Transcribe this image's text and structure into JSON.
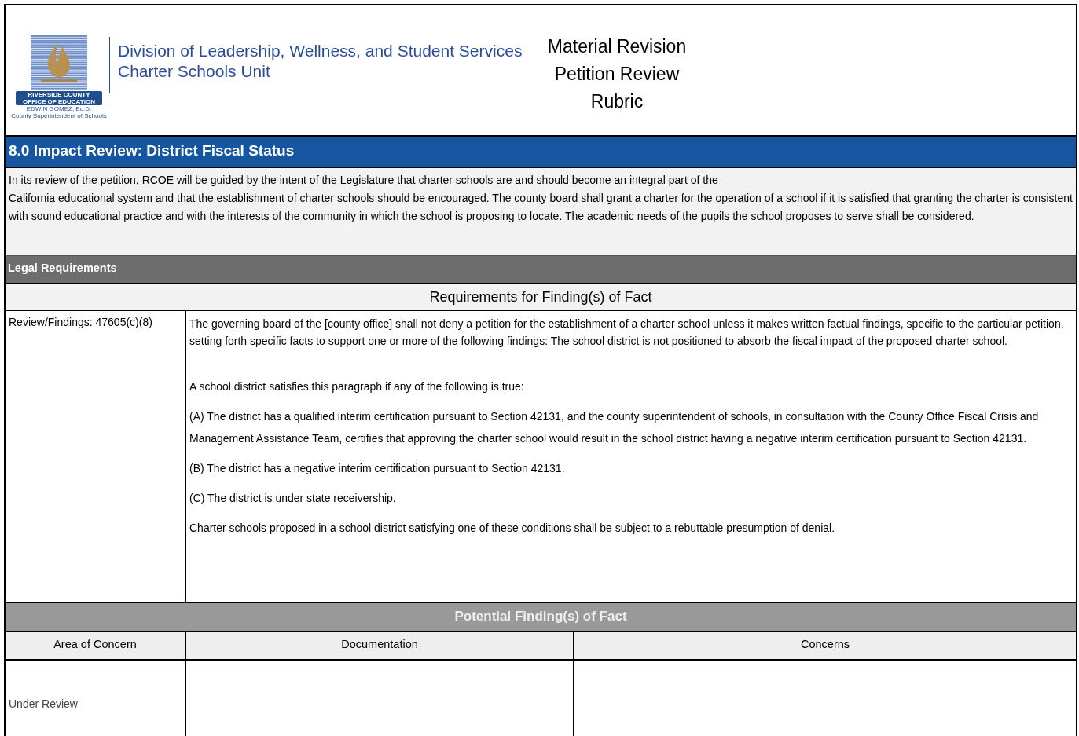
{
  "header": {
    "logo": {
      "badge_lines": [
        "RIVERSIDE COUNTY",
        "OFFICE OF EDUCATION"
      ],
      "name": "EDWIN GOMEZ, Ed.D.",
      "subtitle": "County Superintendent of Schools"
    },
    "division": [
      "Division of Leadership, Wellness, and Student Services",
      "Charter Schools Unit"
    ],
    "title_lines": [
      "Material Revision",
      "Petition Review",
      "Rubric"
    ]
  },
  "section_title": "8.0 Impact Review: District Fiscal Status",
  "intro": [
    "In its review of the petition, RCOE will be guided by the intent of the Legislature that charter schools are and should become an integral part of the",
    "California educational system and that the establishment of charter schools should be encouraged. The county board shall grant a charter for the operation of a school if it is satisfied that granting the charter is consistent with sound educational practice and with the interests of the community in which the school is proposing to locate.  The academic needs of the pupils the school proposes to serve shall be considered."
  ],
  "legal_bar": "Legal Requirements",
  "requirements_heading": "Requirements for Finding(s) of Fact",
  "review": {
    "label": "Review/Findings: 47605(c)(8)",
    "paragraphs": [
      "The governing board of the [county office] shall not deny a petition for the establishment of a charter school unless it makes written factual findings, specific to the particular petition, setting forth specific facts to support one or more of the following findings: The school district is not positioned to absorb the fiscal impact of the proposed charter school.",
      "A school district satisfies this paragraph if any of the following is true:",
      "(A) The district has a qualified interim certification pursuant to Section 42131, and the county superintendent of schools, in consultation with the County Office Fiscal Crisis and Management Assistance Team, certifies that approving the charter school would result in the school district having a negative interim certification pursuant to Section 42131.",
      "(B) The district has a negative interim certification pursuant to Section 42131.",
      "(C) The district is under state receivership.",
      "Charter schools proposed in a school district satisfying one of these conditions shall be subject to a rebuttable presumption of denial."
    ]
  },
  "findings": {
    "title": "Potential Finding(s) of Fact",
    "columns": [
      "Area of Concern",
      "Documentation",
      "Concerns"
    ],
    "rows": [
      [
        "Under Review",
        "",
        ""
      ]
    ]
  }
}
